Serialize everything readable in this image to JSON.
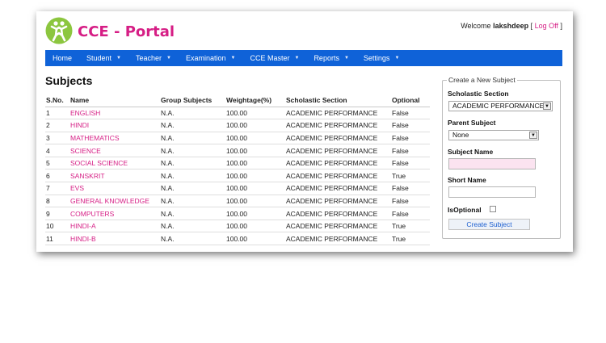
{
  "header": {
    "app_title": "CCE - Portal",
    "welcome_prefix": "Welcome",
    "username": "lakshdeep",
    "logoff_label": "Log Off"
  },
  "nav": [
    {
      "label": "Home",
      "dropdown": false
    },
    {
      "label": "Student",
      "dropdown": true
    },
    {
      "label": "Teacher",
      "dropdown": true
    },
    {
      "label": "Examination",
      "dropdown": true
    },
    {
      "label": "CCE Master",
      "dropdown": true
    },
    {
      "label": "Reports",
      "dropdown": true
    },
    {
      "label": "Settings",
      "dropdown": true
    }
  ],
  "page_title": "Subjects",
  "table": {
    "columns": [
      "S.No.",
      "Name",
      "Group Subjects",
      "Weightage(%)",
      "Scholastic Section",
      "Optional"
    ],
    "rows": [
      [
        "1",
        "ENGLISH",
        "N.A.",
        "100.00",
        "ACADEMIC PERFORMANCE",
        "False"
      ],
      [
        "2",
        "HINDI",
        "N.A.",
        "100.00",
        "ACADEMIC PERFORMANCE",
        "False"
      ],
      [
        "3",
        "MATHEMATICS",
        "N.A.",
        "100.00",
        "ACADEMIC PERFORMANCE",
        "False"
      ],
      [
        "4",
        "SCIENCE",
        "N.A.",
        "100.00",
        "ACADEMIC PERFORMANCE",
        "False"
      ],
      [
        "5",
        "SOCIAL SCIENCE",
        "N.A.",
        "100.00",
        "ACADEMIC PERFORMANCE",
        "False"
      ],
      [
        "6",
        "SANSKRIT",
        "N.A.",
        "100.00",
        "ACADEMIC PERFORMANCE",
        "True"
      ],
      [
        "7",
        "EVS",
        "N.A.",
        "100.00",
        "ACADEMIC PERFORMANCE",
        "False"
      ],
      [
        "8",
        "GENERAL KNOWLEDGE",
        "N.A.",
        "100.00",
        "ACADEMIC PERFORMANCE",
        "False"
      ],
      [
        "9",
        "COMPUTERS",
        "N.A.",
        "100.00",
        "ACADEMIC PERFORMANCE",
        "False"
      ],
      [
        "10",
        "HINDI-A",
        "N.A.",
        "100.00",
        "ACADEMIC PERFORMANCE",
        "True"
      ],
      [
        "11",
        "HINDI-B",
        "N.A.",
        "100.00",
        "ACADEMIC PERFORMANCE",
        "True"
      ]
    ]
  },
  "form": {
    "legend": "Create a New Subject",
    "scholastic_section_label": "Scholastic Section",
    "scholastic_section_value": "ACADEMIC PERFORMANCE",
    "parent_subject_label": "Parent Subject",
    "parent_subject_value": "None",
    "subject_name_label": "Subject Name",
    "subject_name_value": "",
    "short_name_label": "Short Name",
    "short_name_value": "",
    "is_optional_label": "IsOptional",
    "is_optional_checked": false,
    "create_button_label": "Create Subject"
  },
  "colors": {
    "brand": "#d61e85",
    "nav_bg": "#0f62d8",
    "required_field_bg": "#fbe3f0",
    "logo_green": "#8cc63f"
  }
}
